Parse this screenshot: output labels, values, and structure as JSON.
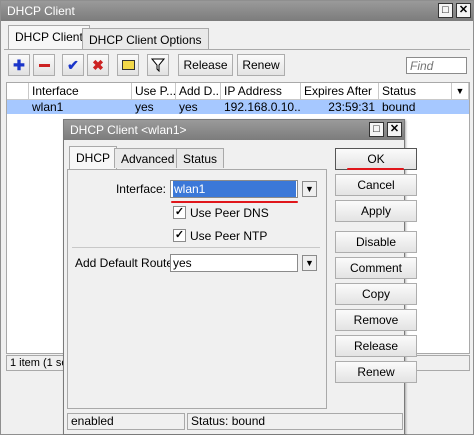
{
  "outer": {
    "title": "DHCP Client",
    "tabs": [
      "DHCP Client",
      "DHCP Client Options"
    ],
    "toolbar": {
      "release_label": "Release",
      "renew_label": "Renew",
      "find_placeholder": "Find"
    },
    "table": {
      "columns": [
        "Interface",
        "Use P...",
        "Add D...",
        "IP Address",
        "Expires After",
        "Status"
      ],
      "rows": [
        {
          "interface": "wlan1",
          "use_peer": "yes",
          "add_default": "yes",
          "ip": "192.168.0.10...",
          "expires": "23:59:31",
          "status": "bound"
        }
      ]
    },
    "status_text": "1 item (1 se"
  },
  "dialog": {
    "title": "DHCP Client <wlan1>",
    "tabs": [
      "DHCP",
      "Advanced",
      "Status"
    ],
    "interface_label": "Interface:",
    "interface_value": "wlan1",
    "use_peer_dns_label": "Use Peer DNS",
    "use_peer_ntp_label": "Use Peer NTP",
    "add_default_route_label": "Add Default Route:",
    "add_default_route_value": "yes",
    "buttons": [
      "OK",
      "Cancel",
      "Apply",
      "Disable",
      "Comment",
      "Copy",
      "Remove",
      "Release",
      "Renew"
    ],
    "status_left": "enabled",
    "status_right": "Status: bound"
  },
  "colors": {
    "titlebar": "#8a8a8a",
    "selection": "#a6c8ff",
    "highlight_field": "#3b78d8",
    "annotation_red": "#e0161b",
    "add_icon": "#1a35c9",
    "remove_icon": "#cc2222"
  }
}
